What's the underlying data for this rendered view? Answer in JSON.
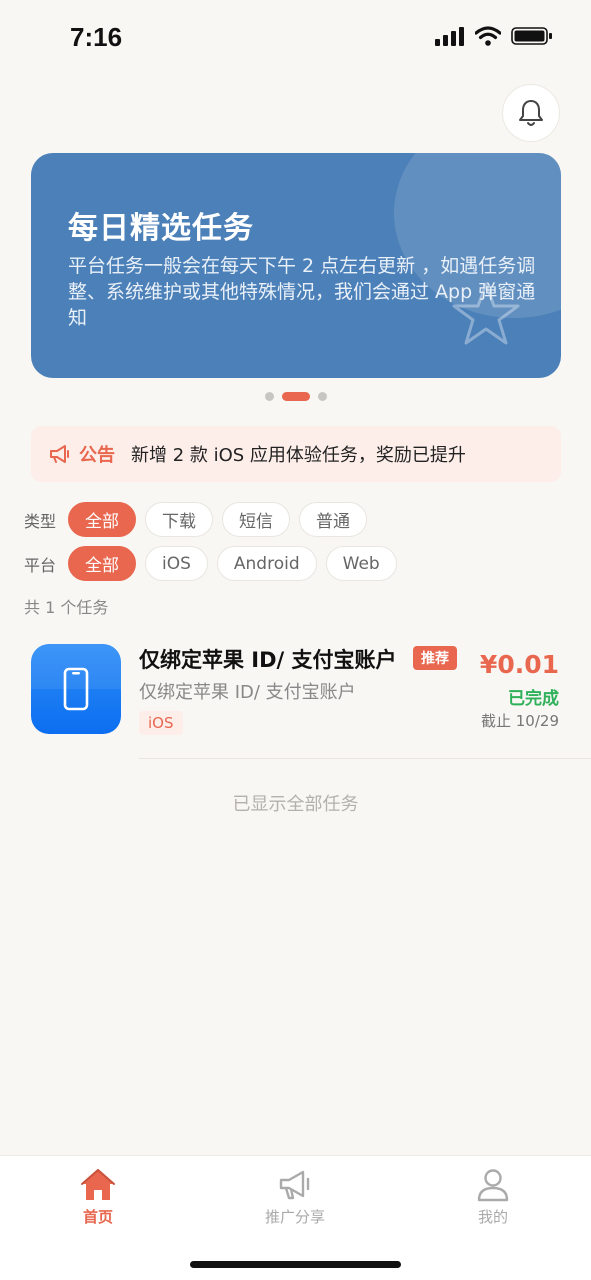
{
  "status_bar": {
    "time": "7:16"
  },
  "header": {
    "notification_icon": "bell-icon"
  },
  "banner": {
    "title": "每日精选任务",
    "description": "平台任务一般会在每天下午 2 点左右更新 ，如遇任务调整、系统维护或其他特殊情况，我们会通过 App 弹窗通知",
    "page_count": 3,
    "active_page": 2
  },
  "notice": {
    "label": "公告",
    "text": "新增 2 款 iOS 应用体验任务，奖励已提升"
  },
  "filters": {
    "type": {
      "label": "类型",
      "options": [
        "全部",
        "下载",
        "短信",
        "普通"
      ],
      "selected": "全部"
    },
    "platform": {
      "label": "平台",
      "options": [
        "全部",
        "iOS",
        "Android",
        "Web"
      ],
      "selected": "全部"
    }
  },
  "task_count_text": "共 1 个任务",
  "tasks": [
    {
      "title": "仅绑定苹果 ID/ 支付宝账户",
      "tag": "推荐",
      "subtitle": "仅绑定苹果 ID/ 支付宝账户",
      "platform": "iOS",
      "price": "¥0.01",
      "status": "已完成",
      "deadline": "截止 10/29",
      "icon": "phone-icon"
    }
  ],
  "end_text": "已显示全部任务",
  "tab_bar": {
    "items": [
      {
        "label": "首页",
        "icon": "home-icon",
        "active": true
      },
      {
        "label": "推广分享",
        "icon": "megaphone-icon",
        "active": false
      },
      {
        "label": "我的",
        "icon": "user-icon",
        "active": false
      }
    ]
  },
  "colors": {
    "accent": "#e8674e",
    "banner": "#4c80b8",
    "success": "#2fb05a",
    "background": "#f8f7f3"
  }
}
